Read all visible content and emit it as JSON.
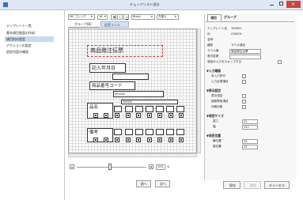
{
  "window": {
    "title": "チェックリスト設計"
  },
  "sidebar": {
    "items": [
      {
        "label": "テンプレート一覧"
      },
      {
        "label": "基本項目画面の作成"
      },
      {
        "label": "項目別の設定"
      },
      {
        "label": "アクションの設定"
      },
      {
        "label": "設定内容の確認"
      }
    ]
  },
  "toolbar": {
    "font": "MS ゴシック",
    "size": "16",
    "bold": "B",
    "italic": "I",
    "underline": "U",
    "color": "Black",
    "align": "左揃え"
  },
  "tabs": [
    {
      "label": "グループ(B)"
    },
    {
      "label": "配置ラベル"
    }
  ],
  "canvas": {
    "form_title": "商品発注伝票",
    "labels": {
      "order_date": "記入年月日",
      "product_code": "商品番号コード",
      "item": "品名",
      "note": "備考"
    },
    "code1": "000000",
    "code2": "000000"
  },
  "zoom": {
    "value": "100",
    "unit": "%"
  },
  "nav": {
    "prev": "前へ",
    "next": "次へ"
  },
  "properties": {
    "tabs": [
      {
        "label": "項目"
      },
      {
        "label": "グループ"
      }
    ],
    "rows": [
      {
        "label": "テンプレート名",
        "value": "T00001"
      },
      {
        "label": "ID",
        "value": "C00001"
      },
      {
        "label": "名称",
        "value": ""
      },
      {
        "label": "種別",
        "value": "ラベル項目"
      },
      {
        "label": "ラベル値",
        "value": "商品発注伝票"
      },
      {
        "label": "書式変更",
        "value": ""
      },
      {
        "label": "項目の入力をスキップする",
        "value": ""
      }
    ],
    "sections": {
      "input_check": "▼入力確認",
      "display": "▼表示設定",
      "size": "▼項目サイズ",
      "position": "▼項目位置"
    },
    "input_checks": [
      {
        "label": "未入力許可"
      },
      {
        "label": "入力必須項目"
      }
    ],
    "display_checks": [
      {
        "label": "表示項目"
      },
      {
        "label": "読取専用項目"
      },
      {
        "label": "印刷対象"
      }
    ],
    "size": {
      "height_label": "高さ",
      "height": "31",
      "width_label": "幅",
      "width": "151"
    },
    "position": {
      "x_label": "横位置",
      "x": "29",
      "y_label": "縦位置",
      "y": "37"
    }
  },
  "footer": {
    "save": "保存",
    "apply": "適用",
    "cancel": "キャンセル"
  }
}
